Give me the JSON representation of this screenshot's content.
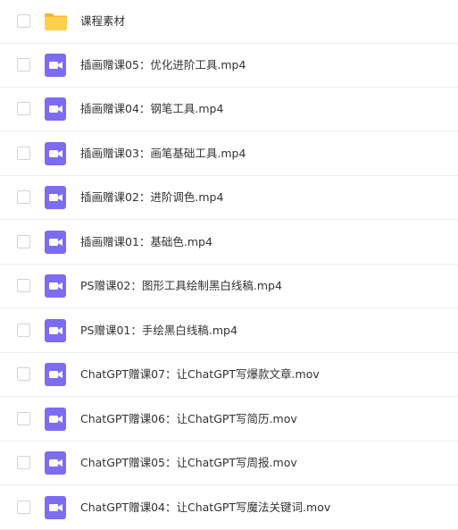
{
  "files": [
    {
      "name": "课程素材",
      "icon": "folder-icon"
    },
    {
      "name": "插画赠课05：优化进阶工具.mp4",
      "icon": "video-file-icon"
    },
    {
      "name": "插画赠课04：钢笔工具.mp4",
      "icon": "video-file-icon"
    },
    {
      "name": "插画赠课03：画笔基础工具.mp4",
      "icon": "video-file-icon"
    },
    {
      "name": "插画赠课02：进阶调色.mp4",
      "icon": "video-file-icon"
    },
    {
      "name": "插画赠课01：基础色.mp4",
      "icon": "video-file-icon"
    },
    {
      "name": "PS赠课02：图形工具绘制黑白线稿.mp4",
      "icon": "video-file-icon"
    },
    {
      "name": "PS赠课01：手绘黑白线稿.mp4",
      "icon": "video-file-icon"
    },
    {
      "name": "ChatGPT赠课07：让ChatGPT写爆款文章.mov",
      "icon": "video-file-icon"
    },
    {
      "name": "ChatGPT赠课06：让ChatGPT写简历.mov",
      "icon": "video-file-icon"
    },
    {
      "name": "ChatGPT赠课05：让ChatGPT写周报.mov",
      "icon": "video-file-icon"
    },
    {
      "name": "ChatGPT赠课04：让ChatGPT写魔法关键词.mov",
      "icon": "video-file-icon"
    }
  ],
  "colors": {
    "folder": "#ffcf4d",
    "folder_tab": "#f5b82a",
    "video": "#7c6cf0",
    "text": "#333333",
    "divider": "#eeeeee"
  }
}
